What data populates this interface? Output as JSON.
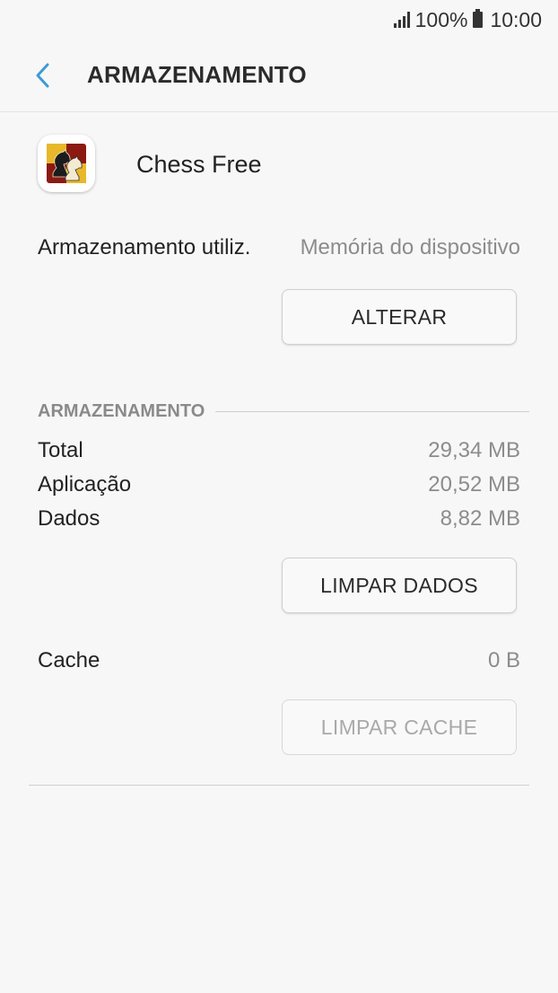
{
  "status_bar": {
    "battery": "100%",
    "time": "10:00"
  },
  "header": {
    "title": "ARMAZENAMENTO",
    "back_icon": "chevron-left-icon"
  },
  "app": {
    "name": "Chess Free",
    "icon": "chess-knight-icon"
  },
  "storage_used": {
    "label": "Armazenamento utiliz.",
    "value": "Memória do dispositivo",
    "button_label": "ALTERAR"
  },
  "storage_section": {
    "header": "ARMAZENAMENTO",
    "rows": [
      {
        "label": "Total",
        "value": "29,34 MB"
      },
      {
        "label": "Aplicação",
        "value": "20,52 MB"
      },
      {
        "label": "Dados",
        "value": "8,82 MB"
      }
    ],
    "clear_data_label": "LIMPAR DADOS"
  },
  "cache": {
    "label": "Cache",
    "value": "0 B",
    "clear_cache_label": "LIMPAR CACHE",
    "clear_cache_enabled": false
  },
  "colors": {
    "accent": "#3d9bd6",
    "background": "#f7f7f7",
    "secondary_text": "#8c8c8c"
  }
}
